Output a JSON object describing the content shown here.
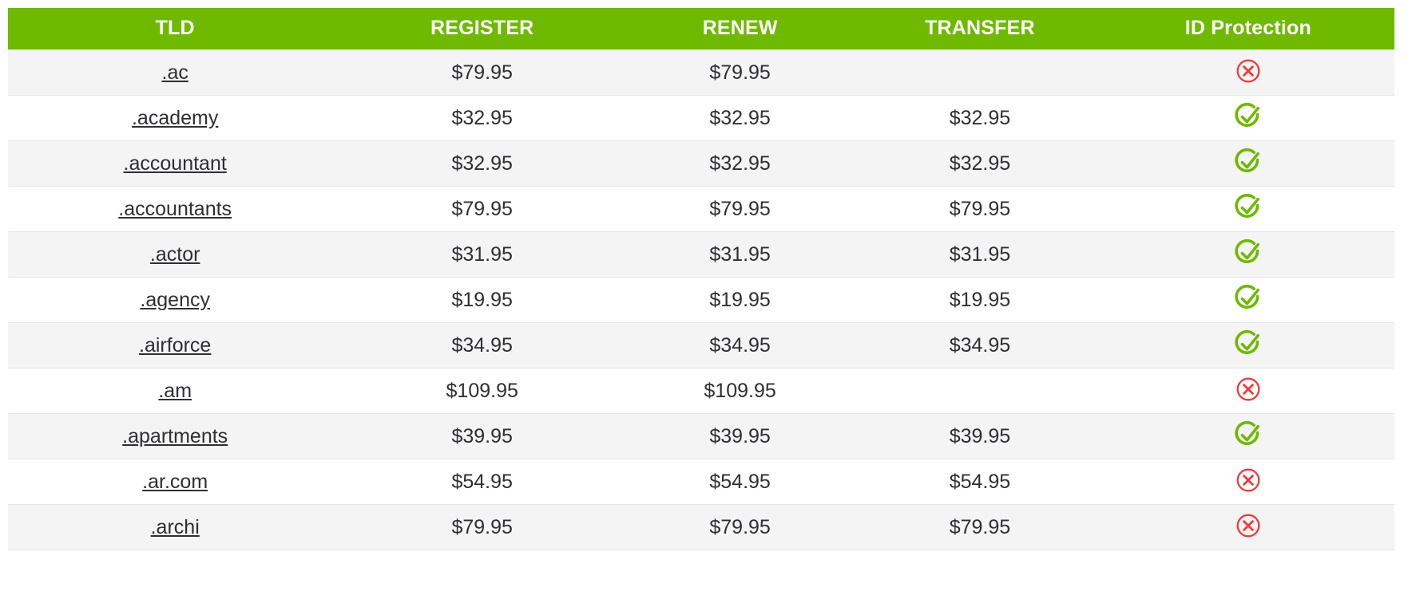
{
  "table": {
    "columns": [
      {
        "key": "tld",
        "label": "TLD"
      },
      {
        "key": "register",
        "label": "REGISTER"
      },
      {
        "key": "renew",
        "label": "RENEW"
      },
      {
        "key": "transfer",
        "label": "TRANSFER"
      },
      {
        "key": "idp",
        "label": "ID Protection"
      }
    ],
    "header_background": "#6fb900",
    "header_text_color": "#ffffff",
    "row_stripe_color": "#f4f4f4",
    "row_base_color": "#ffffff",
    "row_border_color": "#e6e6e6",
    "text_color": "#2f2f33",
    "icons": {
      "available": {
        "name": "check-circle-icon",
        "color": "#6fb900",
        "label": "Included"
      },
      "unavailable": {
        "name": "x-circle-icon",
        "color": "#ef3b3b",
        "label": "Not available"
      }
    },
    "rows": [
      {
        "tld": ".ac",
        "register": "$79.95",
        "renew": "$79.95",
        "transfer": "",
        "idp": "unavailable"
      },
      {
        "tld": ".academy",
        "register": "$32.95",
        "renew": "$32.95",
        "transfer": "$32.95",
        "idp": "available"
      },
      {
        "tld": ".accountant",
        "register": "$32.95",
        "renew": "$32.95",
        "transfer": "$32.95",
        "idp": "available"
      },
      {
        "tld": ".accountants",
        "register": "$79.95",
        "renew": "$79.95",
        "transfer": "$79.95",
        "idp": "available"
      },
      {
        "tld": ".actor",
        "register": "$31.95",
        "renew": "$31.95",
        "transfer": "$31.95",
        "idp": "available"
      },
      {
        "tld": ".agency",
        "register": "$19.95",
        "renew": "$19.95",
        "transfer": "$19.95",
        "idp": "available"
      },
      {
        "tld": ".airforce",
        "register": "$34.95",
        "renew": "$34.95",
        "transfer": "$34.95",
        "idp": "available"
      },
      {
        "tld": ".am",
        "register": "$109.95",
        "renew": "$109.95",
        "transfer": "",
        "idp": "unavailable"
      },
      {
        "tld": ".apartments",
        "register": "$39.95",
        "renew": "$39.95",
        "transfer": "$39.95",
        "idp": "available"
      },
      {
        "tld": ".ar.com",
        "register": "$54.95",
        "renew": "$54.95",
        "transfer": "$54.95",
        "idp": "unavailable"
      },
      {
        "tld": ".archi",
        "register": "$79.95",
        "renew": "$79.95",
        "transfer": "$79.95",
        "idp": "unavailable"
      }
    ]
  }
}
